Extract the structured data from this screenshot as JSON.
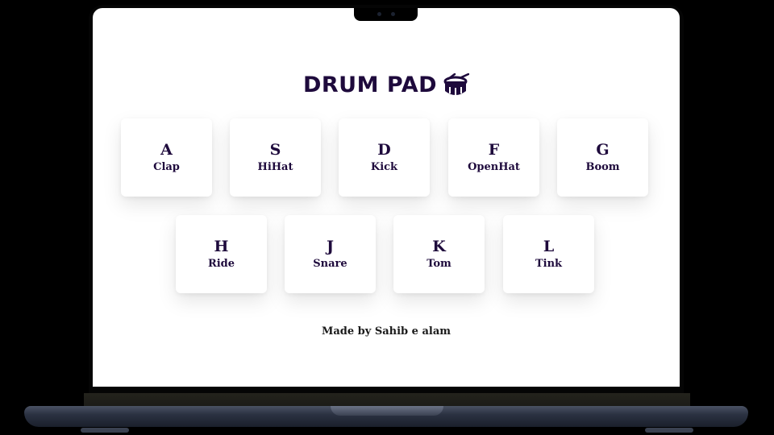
{
  "app": {
    "title": "DRUM PAD",
    "title_icon": "drum-icon",
    "accent_color": "#1e0a3c"
  },
  "pads": {
    "row1": [
      {
        "key": "A",
        "sound": "Clap"
      },
      {
        "key": "S",
        "sound": "HiHat"
      },
      {
        "key": "D",
        "sound": "Kick"
      },
      {
        "key": "F",
        "sound": "OpenHat"
      },
      {
        "key": "G",
        "sound": "Boom"
      }
    ],
    "row2": [
      {
        "key": "H",
        "sound": "Ride"
      },
      {
        "key": "J",
        "sound": "Snare"
      },
      {
        "key": "K",
        "sound": "Tom"
      },
      {
        "key": "L",
        "sound": "Tink"
      }
    ]
  },
  "footer": {
    "text": "Made by Sahib e alam"
  }
}
